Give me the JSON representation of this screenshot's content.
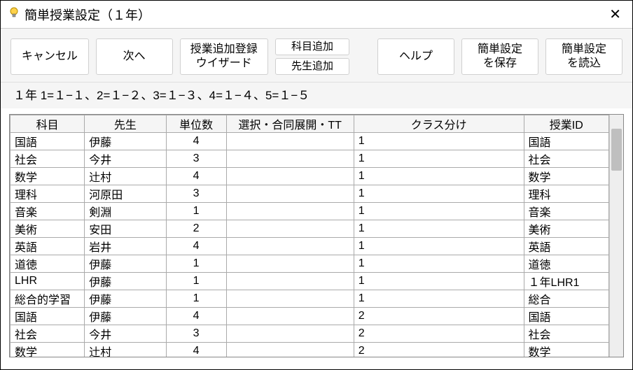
{
  "window": {
    "title": "簡単授業設定（１年）"
  },
  "toolbar": {
    "cancel": "キャンセル",
    "next": "次へ",
    "wizard": "授業追加登録\nウイザード",
    "add_subject": "科目追加",
    "add_teacher": "先生追加",
    "help": "ヘルプ",
    "save": "簡単設定\nを保存",
    "load": "簡単設定\nを読込"
  },
  "info_line": "１年  1=１−１、2=１−２、3=１−３、4=１−４、5=１−５",
  "grid": {
    "headers": {
      "subject": "科目",
      "teacher": "先生",
      "units": "単位数",
      "option": "選択・合同展開・TT",
      "class": "クラス分け",
      "lesson_id": "授業ID"
    },
    "rows": [
      {
        "subject": "国語",
        "teacher": "伊藤",
        "units": "4",
        "option": "",
        "class": "1",
        "lesson_id": "国語"
      },
      {
        "subject": "社会",
        "teacher": "今井",
        "units": "3",
        "option": "",
        "class": "1",
        "lesson_id": "社会"
      },
      {
        "subject": "数学",
        "teacher": "辻村",
        "units": "4",
        "option": "",
        "class": "1",
        "lesson_id": "数学"
      },
      {
        "subject": "理科",
        "teacher": "河原田",
        "units": "3",
        "option": "",
        "class": "1",
        "lesson_id": "理科"
      },
      {
        "subject": "音楽",
        "teacher": "剣淵",
        "units": "1",
        "option": "",
        "class": "1",
        "lesson_id": "音楽"
      },
      {
        "subject": "美術",
        "teacher": "安田",
        "units": "2",
        "option": "",
        "class": "1",
        "lesson_id": "美術"
      },
      {
        "subject": "英語",
        "teacher": "岩井",
        "units": "4",
        "option": "",
        "class": "1",
        "lesson_id": "英語"
      },
      {
        "subject": "道徳",
        "teacher": "伊藤",
        "units": "1",
        "option": "",
        "class": "1",
        "lesson_id": "道徳"
      },
      {
        "subject": "LHR",
        "teacher": "伊藤",
        "units": "1",
        "option": "",
        "class": "1",
        "lesson_id": "１年LHR1"
      },
      {
        "subject": "総合的学習",
        "teacher": "伊藤",
        "units": "1",
        "option": "",
        "class": "1",
        "lesson_id": "総合"
      },
      {
        "subject": "国語",
        "teacher": "伊藤",
        "units": "4",
        "option": "",
        "class": "2",
        "lesson_id": "国語"
      },
      {
        "subject": "社会",
        "teacher": "今井",
        "units": "3",
        "option": "",
        "class": "2",
        "lesson_id": "社会"
      },
      {
        "subject": "数学",
        "teacher": "辻村",
        "units": "4",
        "option": "",
        "class": "2",
        "lesson_id": "数学"
      }
    ]
  }
}
